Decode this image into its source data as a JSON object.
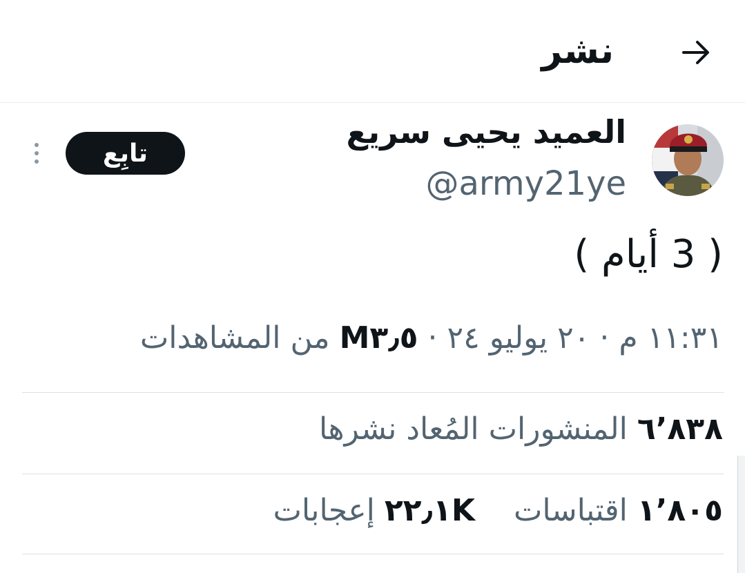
{
  "header": {
    "title": "نشر",
    "back_icon": "arrow-right-icon"
  },
  "author": {
    "name": "العميد يحيى سريع",
    "handle": "@army21ye"
  },
  "follow_label": "تابِع",
  "tweet": {
    "text": "( 3 أيام )"
  },
  "meta": {
    "time": "١١:٣١ م",
    "sep1": "·",
    "date": "٢٠ يوليو ٢٤",
    "sep2": "·",
    "views_count": "M٣٫٥",
    "views_label": "من المشاهدات"
  },
  "stats": {
    "reposts_count": "٦٬٨٣٨",
    "reposts_label": "المنشورات المُعاد نشرها",
    "quotes_count": "١٬٨٠٥",
    "quotes_label": "اقتباسات",
    "likes_count": "٢٢٫١K",
    "likes_label": "إعجابات"
  },
  "colors": {
    "text": "#0f1419",
    "secondary": "#536471",
    "divider": "#d9e1e6",
    "button": "#0f1419"
  }
}
